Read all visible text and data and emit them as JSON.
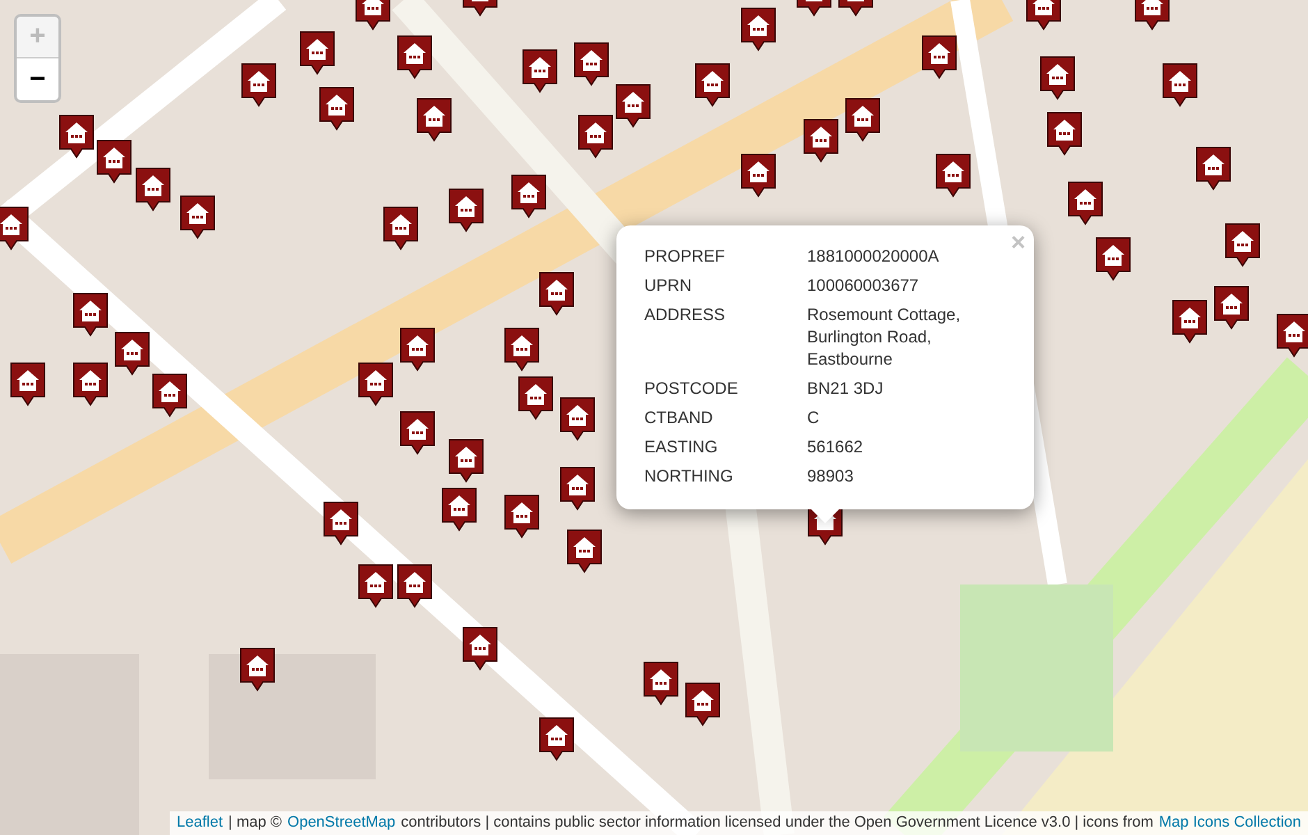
{
  "zoom_controls": [
    {
      "label": "+",
      "kind": "in",
      "disabled": true
    },
    {
      "label": "−",
      "kind": "out",
      "disabled": false
    }
  ],
  "popup": {
    "close": "×",
    "rows": [
      {
        "key": "PROPREF",
        "value": "1881000020000A"
      },
      {
        "key": "UPRN",
        "value": "100060003677"
      },
      {
        "key": "ADDRESS",
        "value": "Rosemount Cottage, Burlington Road, Eastbourne"
      },
      {
        "key": "POSTCODE",
        "value": "BN21 3DJ"
      },
      {
        "key": "CTBAND",
        "value": "C"
      },
      {
        "key": "EASTING",
        "value": "561662"
      },
      {
        "key": "NORTHING",
        "value": "98903"
      }
    ]
  },
  "attribution": [
    {
      "kind": "link",
      "text": "Leaflet"
    },
    {
      "kind": "text",
      "text": "| map ©"
    },
    {
      "kind": "link",
      "text": "OpenStreetMap"
    },
    {
      "kind": "text",
      "text": "contributors | contains public sector information licensed under the Open Government Licence v3.0 | icons from"
    },
    {
      "kind": "link",
      "text": "Map Icons Collection"
    }
  ]
}
